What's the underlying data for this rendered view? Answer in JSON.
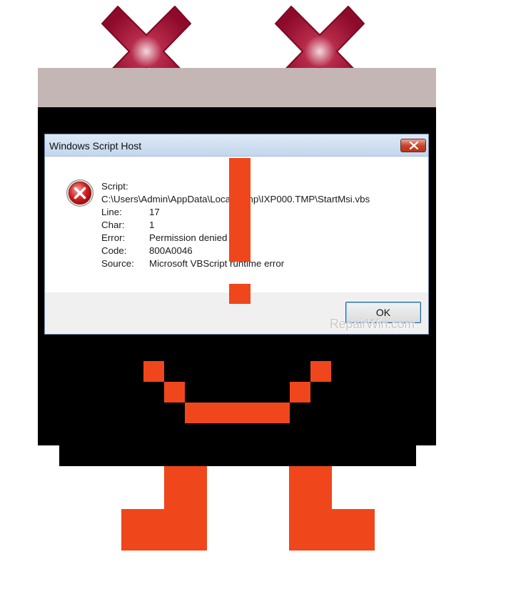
{
  "dialog": {
    "title": "Windows Script Host",
    "icon": "error-icon",
    "script_label": "Script:",
    "script_path": "C:\\Users\\Admin\\AppData\\Local\\Temp\\IXP000.TMP\\StartMsi.vbs",
    "rows": [
      {
        "label": "Line:",
        "value": "17"
      },
      {
        "label": "Char:",
        "value": "1"
      },
      {
        "label": "Error:",
        "value": "Permission denied"
      },
      {
        "label": "Code:",
        "value": "800A0046"
      },
      {
        "label": "Source:",
        "value": "Microsoft VBScript runtime error"
      }
    ],
    "ok_label": "OK"
  },
  "watermark": "RepairWin.com",
  "colors": {
    "x_mark": "#9b0e30",
    "orange": "#f0461c",
    "head_top": "#c4b6b4",
    "body": "#000000"
  }
}
